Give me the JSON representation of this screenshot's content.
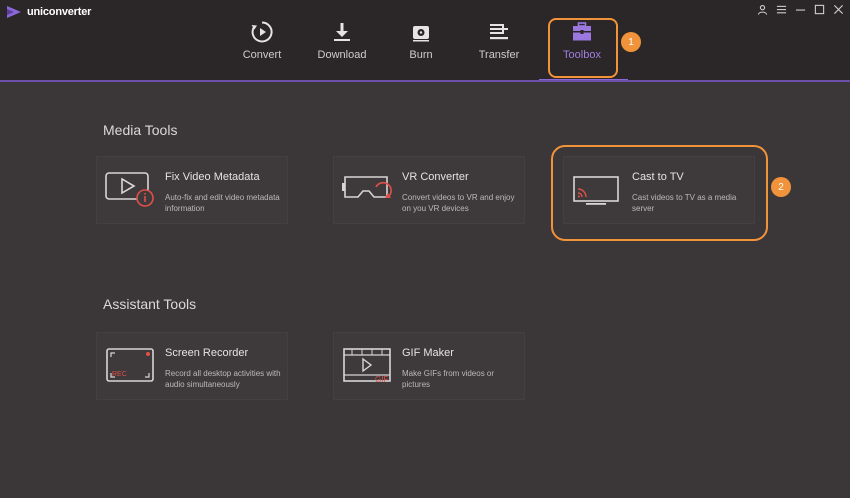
{
  "app": {
    "name": "uniconverter"
  },
  "nav": {
    "tabs": [
      {
        "label": "Convert",
        "icon": "convert-icon"
      },
      {
        "label": "Download",
        "icon": "download-icon"
      },
      {
        "label": "Burn",
        "icon": "burn-icon"
      },
      {
        "label": "Transfer",
        "icon": "transfer-icon"
      },
      {
        "label": "Toolbox",
        "icon": "toolbox-icon",
        "active": true
      }
    ]
  },
  "callouts": [
    "1",
    "2"
  ],
  "sections": {
    "media_tools": {
      "title": "Media Tools",
      "cards": [
        {
          "title": "Fix Video Metadata",
          "desc": "Auto-fix and edit video metadata information",
          "icon": "fix-metadata-icon"
        },
        {
          "title": "VR Converter",
          "desc": "Convert videos to VR and enjoy on you VR devices",
          "icon": "vr-headset-icon"
        },
        {
          "title": "Cast to TV",
          "desc": "Cast videos to TV as a media server",
          "icon": "cast-tv-icon"
        }
      ]
    },
    "assistant_tools": {
      "title": "Assistant Tools",
      "cards": [
        {
          "title": "Screen Recorder",
          "desc": "Record all desktop activities with audio simultaneously",
          "icon": "screen-recorder-icon",
          "badge": "REC"
        },
        {
          "title": "GIF Maker",
          "desc": "Make GIFs from videos or pictures",
          "icon": "gif-maker-icon",
          "badge": "GIF"
        }
      ]
    }
  },
  "colors": {
    "accent": "#8b67d8",
    "highlight": "#f0933a",
    "background": "#3b3638",
    "topbar": "#2b2628",
    "icon_red": "#e0504a"
  }
}
